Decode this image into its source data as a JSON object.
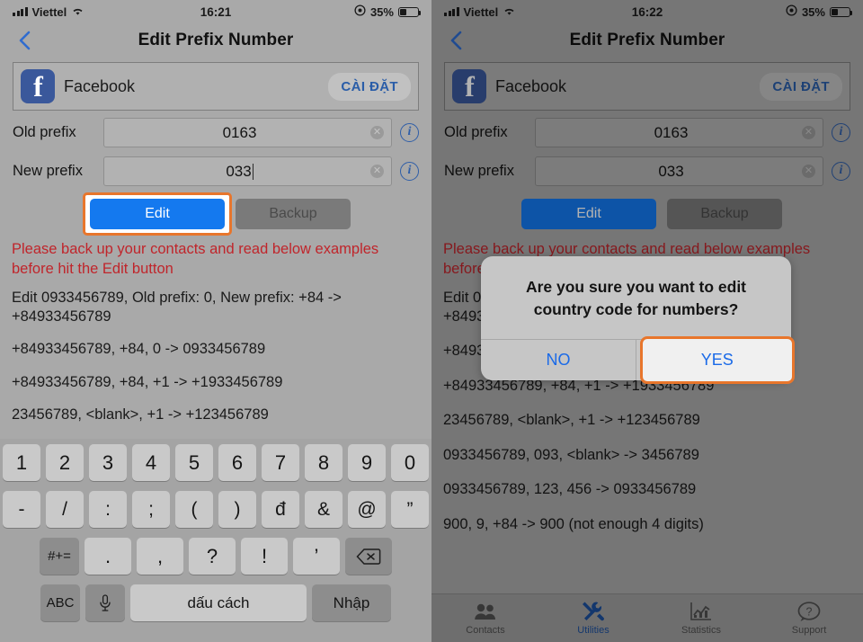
{
  "left": {
    "status": {
      "carrier": "Viettel",
      "time": "16:21",
      "battery": "35%",
      "wifi": "wifi-icon",
      "alarm": "location-icon"
    },
    "nav": {
      "title": "Edit Prefix Number",
      "back": "back-chevron-icon"
    },
    "ad": {
      "name": "Facebook",
      "button": "CÀI ĐẶT",
      "logo": "f"
    },
    "form": {
      "old_label": "Old prefix",
      "old_value": "0163",
      "new_label": "New prefix",
      "new_value": "033",
      "clear": "✕",
      "info": "i"
    },
    "actions": {
      "edit": "Edit",
      "backup": "Backup"
    },
    "warning": "Please back up your contacts and read below examples before hit the Edit button",
    "examples": [
      "Edit 0933456789, Old prefix: 0, New prefix: +84 -> +84933456789",
      "+84933456789, +84, 0 -> 0933456789",
      "+84933456789, +84, +1 -> +1933456789",
      "23456789, <blank>, +1 -> +123456789"
    ],
    "keyboard": {
      "row1": [
        "1",
        "2",
        "3",
        "4",
        "5",
        "6",
        "7",
        "8",
        "9",
        "0"
      ],
      "row2": [
        "-",
        "/",
        ":",
        ";",
        "(",
        ")",
        "đ",
        "&",
        "@",
        "”"
      ],
      "row3_fn": "#+=",
      "row3": [
        ".",
        ",",
        "?",
        "!",
        "’"
      ],
      "row3_bsp": "backspace-icon",
      "row4_abc": "ABC",
      "row4_mic": "microphone-icon",
      "row4_space": "dấu cách",
      "row4_enter": "Nhập"
    }
  },
  "right": {
    "status": {
      "carrier": "Viettel",
      "time": "16:22",
      "battery": "35%"
    },
    "nav": {
      "title": "Edit Prefix Number"
    },
    "ad": {
      "name": "Facebook",
      "button": "CÀI ĐẶT",
      "logo": "f"
    },
    "form": {
      "old_label": "Old prefix",
      "old_value": "0163",
      "new_label": "New prefix",
      "new_value": "033"
    },
    "actions": {
      "edit": "Edit",
      "backup": "Backup"
    },
    "warning": "Please back up your contacts and read below examples before hit the Edit button",
    "examples": [
      "Edit 0933456789, Old prefix: 0, New prefix: +84 -> +84933456789",
      "+84933456789, +84, 0 -> 0933456789",
      "+84933456789, +84, +1 -> +1933456789",
      "23456789, <blank>, +1 -> +123456789",
      "0933456789, 093, <blank> -> 3456789",
      "0933456789, 123, 456 -> 0933456789",
      "900, 9, +84 -> 900 (not enough 4 digits)"
    ],
    "dialog": {
      "message": "Are you sure you want to edit country code for numbers?",
      "no": "NO",
      "yes": "YES"
    },
    "tabs": [
      {
        "label": "Contacts",
        "icon": "contacts-icon"
      },
      {
        "label": "Utilities",
        "icon": "tools-icon"
      },
      {
        "label": "Statistics",
        "icon": "chart-icon"
      },
      {
        "label": "Support",
        "icon": "question-bubble-icon"
      }
    ]
  },
  "colors": {
    "accent_blue": "#1479ef",
    "highlight_orange": "#e8762c",
    "warning_red": "#c0252b",
    "fb_blue": "#3a589b"
  }
}
